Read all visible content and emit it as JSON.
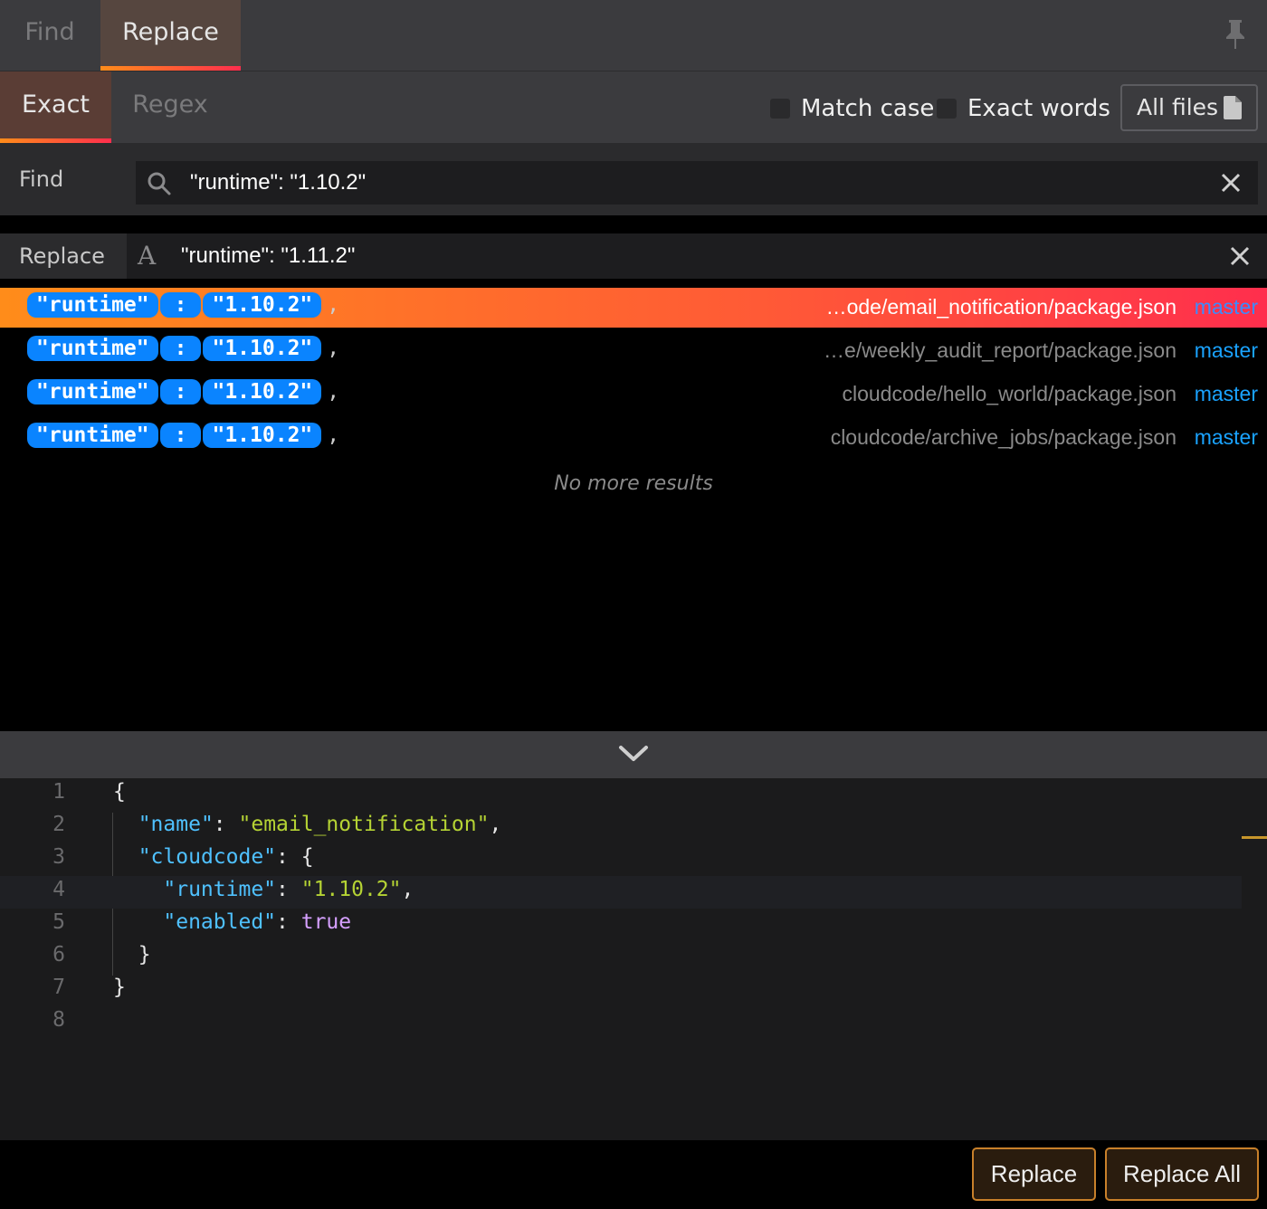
{
  "tabs": {
    "find": "Find",
    "replace": "Replace",
    "active": "Replace"
  },
  "modes": {
    "exact": "Exact",
    "regex": "Regex",
    "active": "Exact"
  },
  "options": {
    "match_case": {
      "label": "Match case",
      "checked": false
    },
    "exact_words": {
      "label": "Exact words",
      "checked": false
    },
    "scope": "All files"
  },
  "find": {
    "label": "Find",
    "value": "\"runtime\": \"1.10.2\""
  },
  "replace": {
    "label": "Replace",
    "value": "\"runtime\": \"1.11.2\""
  },
  "results": [
    {
      "key": "\"runtime\"",
      "sep": ":",
      "value": "\"1.10.2\"",
      "trail": ",",
      "path": "…ode/email_notification/package.json",
      "branch": "master",
      "selected": true
    },
    {
      "key": "\"runtime\"",
      "sep": ":",
      "value": "\"1.10.2\"",
      "trail": ",",
      "path": "…e/weekly_audit_report/package.json",
      "branch": "master",
      "selected": false
    },
    {
      "key": "\"runtime\"",
      "sep": ":",
      "value": "\"1.10.2\"",
      "trail": ",",
      "path": "cloudcode/hello_world/package.json",
      "branch": "master",
      "selected": false
    },
    {
      "key": "\"runtime\"",
      "sep": ":",
      "value": "\"1.10.2\"",
      "trail": ",",
      "path": "cloudcode/archive_jobs/package.json",
      "branch": "master",
      "selected": false
    }
  ],
  "no_more_results": "No more results",
  "editor": {
    "line_numbers": [
      "1",
      "2",
      "3",
      "4",
      "5",
      "6",
      "7",
      "8"
    ],
    "lines": {
      "l1": "{",
      "l2_key": "\"name\"",
      "l2_colon": ": ",
      "l2_val": "\"email_notification\"",
      "l2_end": ",",
      "l3_key": "\"cloudcode\"",
      "l3_end": ": {",
      "l4_key": "\"runtime\"",
      "l4_colon": ": ",
      "l4_val": "\"1.10.2\"",
      "l4_end": ",",
      "l5_key": "\"enabled\"",
      "l5_colon": ": ",
      "l5_val": "true",
      "l6": "}",
      "l7": "}"
    },
    "active_line": "4"
  },
  "buttons": {
    "replace": "Replace",
    "replace_all": "Replace All"
  },
  "colors": {
    "accent_start": "#ff8c1a",
    "accent_end": "#ff2e4d",
    "match_pill": "#0a84ff",
    "branch": "#1aa3ff"
  },
  "icons": [
    "pin-icon",
    "file-icon",
    "search-icon",
    "font-icon",
    "close-icon",
    "chevron-down-icon"
  ]
}
